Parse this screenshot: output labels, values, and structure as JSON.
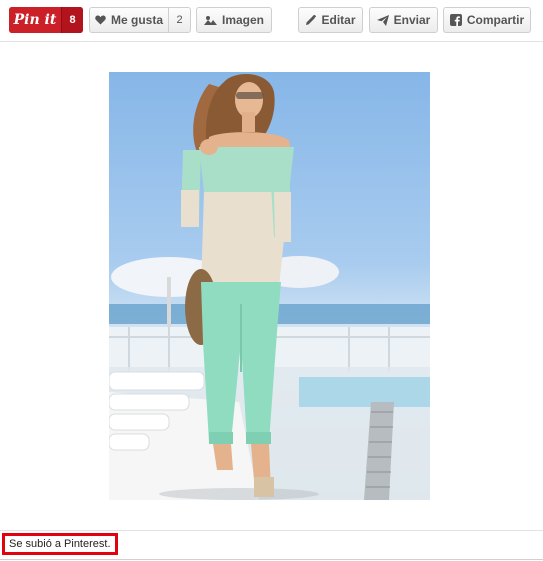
{
  "toolbar": {
    "pin_it": {
      "label": "Pin it",
      "count": "8"
    },
    "like": {
      "label": "Me gusta",
      "count": "2"
    },
    "image": {
      "label": "Imagen"
    },
    "edit": {
      "label": "Editar"
    },
    "send": {
      "label": "Enviar"
    },
    "share": {
      "label": "Compartir"
    }
  },
  "photo": {
    "subject": "woman in mint green trousers and striped sweater on a beach deck"
  },
  "status": {
    "text": "Se subió a Pinterest."
  },
  "colors": {
    "pinterest_red": "#cb2027",
    "status_border": "#e3000f",
    "trousers": "#8fdcc0"
  },
  "icons": [
    "heart-icon",
    "image-icon",
    "pencil-icon",
    "paper-plane-icon",
    "facebook-icon"
  ]
}
